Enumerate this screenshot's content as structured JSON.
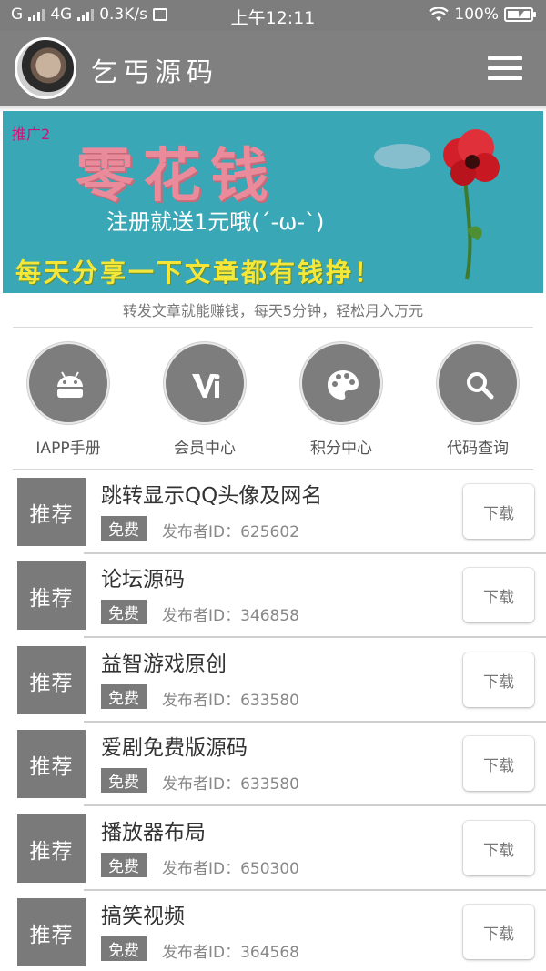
{
  "status_bar": {
    "network_left": "G",
    "network_mid": "4G",
    "speed": "0.3K/s",
    "time": "上午12:11",
    "battery": "100%"
  },
  "header": {
    "title": "乞丐源码",
    "avatar_icon": "user-avatar",
    "menu_icon": "hamburger-menu-icon"
  },
  "banner": {
    "tag": "推广2",
    "title": "零花钱",
    "subtitle": "注册就送1元哦(´-ω-`)",
    "slogan": "每天分享一下文章都有钱挣！"
  },
  "caption": "转发文章就能赚钱，每天5分钟，轻松月入万元",
  "quick_links": [
    {
      "label": "IAPP手册",
      "icon": "android-icon"
    },
    {
      "label": "会员中心",
      "icon": "vip-icon"
    },
    {
      "label": "积分中心",
      "icon": "palette-icon"
    },
    {
      "label": "代码查询",
      "icon": "search-icon"
    }
  ],
  "list": {
    "tag_label": "推荐",
    "free_label": "免费",
    "download_label": "下载",
    "items": [
      {
        "title": "跳转显示QQ头像及网名",
        "publisher": "发布者ID：625602"
      },
      {
        "title": "论坛源码",
        "publisher": "发布者ID：346858"
      },
      {
        "title": "益智游戏原创",
        "publisher": "发布者ID：633580"
      },
      {
        "title": "爱剧免费版源码",
        "publisher": "发布者ID：633580"
      },
      {
        "title": "播放器布局",
        "publisher": "发布者ID：650300"
      },
      {
        "title": "搞笑视频",
        "publisher": "发布者ID：364568"
      }
    ]
  },
  "colors": {
    "header_gray": "#808080",
    "tag_gray": "#7a7a7a",
    "banner_teal": "#39a7b5",
    "banner_pink": "#e98b9a",
    "banner_yellow": "#f4e73a"
  }
}
